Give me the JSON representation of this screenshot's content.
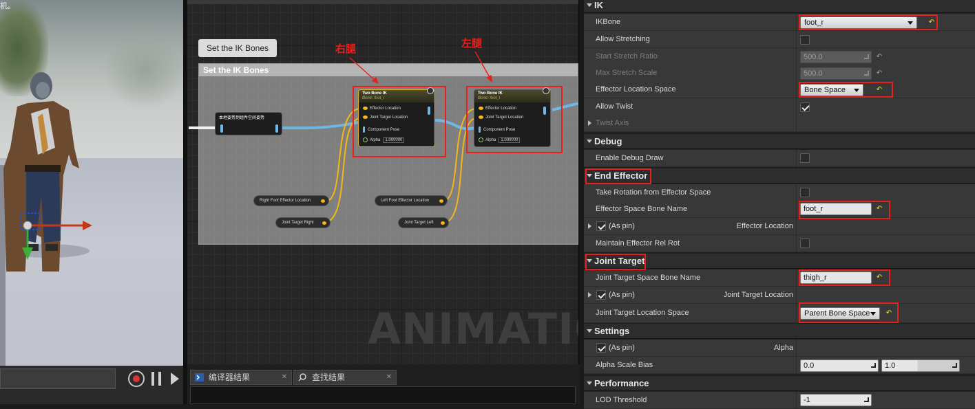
{
  "viewport": {
    "corner_text": "机。"
  },
  "graph": {
    "comment_tooltip": "Set the IK Bones",
    "comment_title": "Set the IK Bones",
    "watermark": "ANIMATION",
    "annotations": {
      "right_leg": "右腿",
      "left_leg": "左腿"
    },
    "convert_node": {
      "title": "本地姿势到组件空间姿势"
    },
    "ik_nodes": [
      {
        "title": "Two Bone IK",
        "subtitle": "Bone: foot_r",
        "pins": [
          "Effector Location",
          "Joint Target Location",
          "Component Pose"
        ],
        "alpha_label": "Alpha",
        "alpha_value": "1.000000"
      },
      {
        "title": "Two Bone IK",
        "subtitle": "Bone: foot_l",
        "pins": [
          "Effector Location",
          "Joint Target Location",
          "Component Pose"
        ],
        "alpha_label": "Alpha",
        "alpha_value": "1.000000"
      }
    ],
    "variables": {
      "right_effector": "Right Foot Effector Location",
      "joint_right": "Joint Target Right",
      "left_effector": "Left Foot Effector Location",
      "joint_left": "Joint Target Left"
    }
  },
  "bottom_tabs": [
    {
      "label": "编译器结果"
    },
    {
      "label": "查找结果"
    }
  ],
  "details": {
    "ik": {
      "header": "IK",
      "ik_bone": {
        "label": "IKBone",
        "value": "foot_r"
      },
      "allow_stretching": {
        "label": "Allow Stretching"
      },
      "start_stretch_ratio": {
        "label": "Start Stretch Ratio",
        "value": "500.0"
      },
      "max_stretch_scale": {
        "label": "Max Stretch Scale",
        "value": "500.0"
      },
      "effector_location_space": {
        "label": "Effector Location Space",
        "value": "Bone Space"
      },
      "allow_twist": {
        "label": "Allow Twist"
      },
      "twist_axis": {
        "label": "Twist Axis"
      }
    },
    "debug": {
      "header": "Debug",
      "enable_debug_draw": {
        "label": "Enable Debug Draw"
      }
    },
    "end_effector": {
      "header": "End Effector",
      "take_rotation": {
        "label": "Take Rotation from Effector Space"
      },
      "effector_space_bone_name": {
        "label": "Effector Space Bone Name",
        "value": "foot_r"
      },
      "as_pin": {
        "label": "(As pin)",
        "right": "Effector Location"
      },
      "maintain_rel_rot": {
        "label": "Maintain Effector Rel Rot"
      }
    },
    "joint_target": {
      "header": "Joint Target",
      "space_bone_name": {
        "label": "Joint Target Space Bone Name",
        "value": "thigh_r"
      },
      "as_pin": {
        "label": "(As pin)",
        "right": "Joint Target Location"
      },
      "location_space": {
        "label": "Joint Target Location Space",
        "value": "Parent Bone Space"
      }
    },
    "settings": {
      "header": "Settings",
      "as_pin": {
        "label": "(As pin)",
        "right": "Alpha"
      },
      "alpha_scale_bias": {
        "label": "Alpha Scale Bias",
        "min": "0.0",
        "max": "1.0"
      }
    },
    "performance": {
      "header": "Performance",
      "lod_threshold": {
        "label": "LOD Threshold",
        "value": "-1"
      }
    }
  },
  "colors": {
    "accent_red": "#e8201c",
    "wire_blue": "#6db8e8",
    "pin_yellow": "#f5b718"
  }
}
